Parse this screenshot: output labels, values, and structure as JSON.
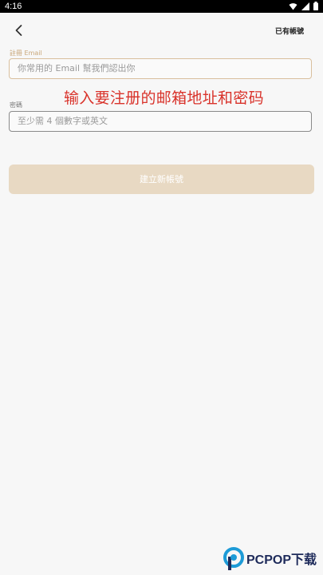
{
  "status_bar": {
    "time": "4:16"
  },
  "header": {
    "login_link": "已有帳號"
  },
  "form": {
    "email_label": "註冊 Email",
    "email_placeholder": "你常用的 Email 幫我們認出你",
    "password_label": "密碼",
    "password_placeholder": "至少需 4 個數字或英文",
    "submit_label": "建立新帳號"
  },
  "annotation": "输入要注册的邮箱地址和密码",
  "watermark": {
    "text": "PCPOP下载"
  },
  "colors": {
    "accent": "#c9a77a",
    "button": "#e8d9c3",
    "annotation": "#d9332b"
  }
}
